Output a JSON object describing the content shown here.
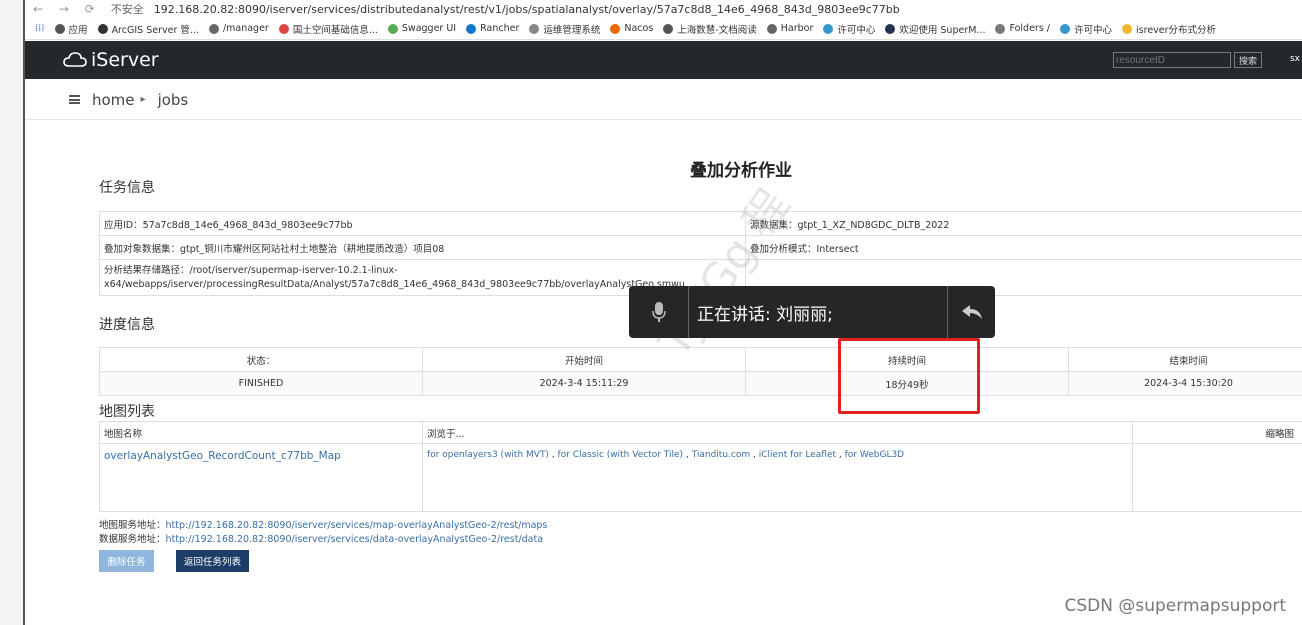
{
  "browser": {
    "insecure_label": "不安全",
    "url": "192.168.20.82:8090/iserver/services/distributedanalyst/rest/v1/jobs/spatialanalyst/overlay/57a7c8d8_14e6_4968_843d_9803ee9c77bb",
    "bookmarks": [
      "应用",
      "ArcGIS Server 管...",
      "/manager",
      "国土空间基础信息...",
      "Swagger UI",
      "Rancher",
      "运维管理系统",
      "Nacos",
      "上海数慧-文档阅读",
      "Harbor",
      "许可中心",
      "欢迎使用 SuperM...",
      "Folders /",
      "许可中心",
      "isrever分布式分析"
    ]
  },
  "header": {
    "logo_text": "iServer",
    "search_placeholder": "resourceID",
    "search_button": "搜索",
    "user_fragment": "sx"
  },
  "breadcrumb": {
    "home": "home",
    "sep": "▸",
    "current": "jobs"
  },
  "page_title": "叠加分析作业",
  "task_info": {
    "heading": "任务信息",
    "app_id": "应用ID：57a7c8d8_14e6_4968_843d_9803ee9c77bb",
    "source_dataset": "源数据集：gtpt_1_XZ_ND8GDC_DLTB_2022",
    "overlay_dataset": "叠加对象数据集：gtpt_铜川市耀州区阿站社村土地整治（耕地提质改造）项目08",
    "overlay_mode": "叠加分析模式：Intersect",
    "result_path": "分析结果存储路径：/root/iserver/supermap-iserver-10.2.1-linux-x64/webapps/iserver/processingResultData/Analyst/57a7c8d8_14e6_4968_843d_9803ee9c77bb/overlayAnalystGeo.smwu"
  },
  "progress": {
    "heading": "进度信息",
    "headers": [
      "状态：",
      "开始时间",
      "持续时间",
      "结束时间"
    ],
    "values": [
      "FINISHED",
      "2024-3-4 15:11:29",
      "18分49秒",
      "2024-3-4 15:30:20"
    ]
  },
  "maps": {
    "heading": "地图列表",
    "headers": [
      "地图名称",
      "浏览于...",
      "缩略图"
    ],
    "map_name": "overlayAnalystGeo_RecordCount_c77bb_Map",
    "browse_links": [
      "for openlayers3 (with MVT)",
      "for Classic (with Vector Tile)",
      "Tianditu.com",
      "iClient for Leaflet",
      "for WebGL3D"
    ],
    "browse_sep": " , "
  },
  "services": {
    "map_label": "地图服务地址：",
    "map_url": "http://192.168.20.82:8090/iserver/services/map-overlayAnalystGeo-2/rest/maps",
    "data_label": "数据服务地址：",
    "data_url": "http://192.168.20.82:8090/iserver/services/data-overlayAnalystGeo-2/rest/data"
  },
  "buttons": {
    "delete": "删除任务",
    "back": "返回任务列表"
  },
  "voice_overlay": {
    "text": "正在讲话: 刘丽丽;"
  },
  "watermark": "TJVGg 程",
  "csdn": "CSDN @supermapsupport",
  "colors": {
    "header_bg": "#23282d",
    "highlight": "#e12020",
    "link": "#3a6fa5",
    "back_btn": "#1b3d66"
  }
}
